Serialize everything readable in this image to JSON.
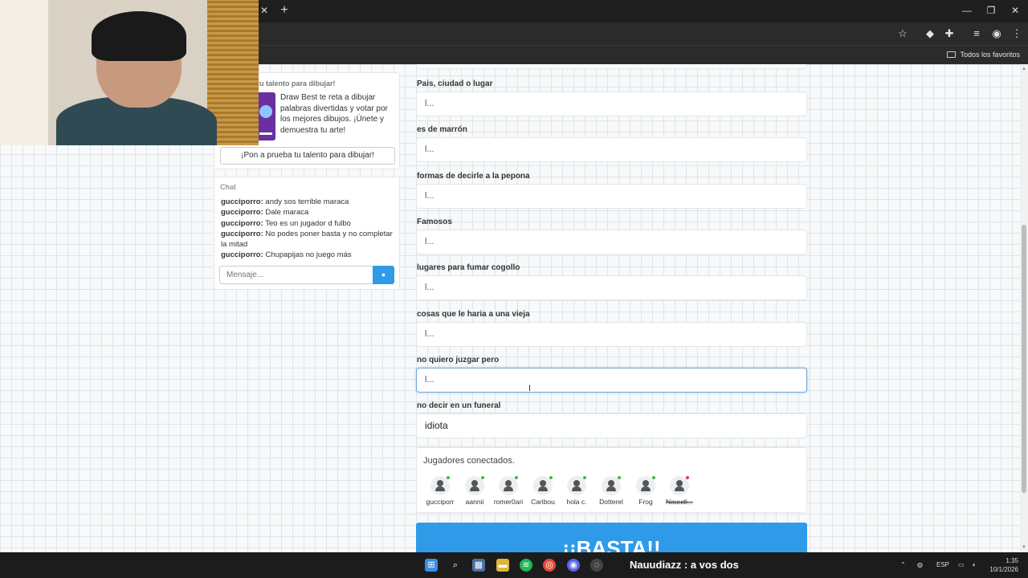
{
  "browser": {
    "tab_close": "✕",
    "tab_new": "+",
    "window_controls": {
      "minimize": "—",
      "maximize": "❐",
      "close": "✕"
    },
    "bookmark_folder_label": "Todos los favoritos"
  },
  "sidebar": {
    "promo": {
      "title": "ba tu talento para dibujar!",
      "description": "Draw Best te reta a dibujar palabras divertidas y votar por los mejores dibujos. ¡Únete y demuestra tu arte!",
      "button_label": "¡Pon a prueba tu talento para dibujar!"
    },
    "chat": {
      "title": "Chat",
      "messages": [
        {
          "user": "gucciporro:",
          "text": " andy sos terrible maraca"
        },
        {
          "user": "gucciporro:",
          "text": " Dale maraca"
        },
        {
          "user": "gucciporro:",
          "text": " Teo es un jugador d fulbo"
        },
        {
          "user": "gucciporro:",
          "text": " No podes poner basta y no completar la mitad"
        },
        {
          "user": "gucciporro:",
          "text": " Chupapijas no juego más"
        }
      ],
      "input_placeholder": "Mensaje..."
    }
  },
  "form": {
    "fields": [
      {
        "label": "Pais, ciudad o lugar",
        "value": "l..."
      },
      {
        "label": "es de marrón",
        "value": "l..."
      },
      {
        "label": "formas de decirle a la pepona",
        "value": "l..."
      },
      {
        "label": "Famosos",
        "value": "l..."
      },
      {
        "label": "lugares para fumar cogollo",
        "value": "l..."
      },
      {
        "label": "cosas que le haria a una vieja",
        "value": "l..."
      },
      {
        "label": "no quiero juzgar pero",
        "value": "l..."
      },
      {
        "label": "no decir en un funeral",
        "value": "idiota"
      }
    ]
  },
  "players": {
    "title": "Jugadores conectados.",
    "list": [
      {
        "name": "gucciporr",
        "status_color": "#4caf50"
      },
      {
        "name": "aannii",
        "status_color": "#4caf50"
      },
      {
        "name": "romer0ari",
        "status_color": "#4caf50"
      },
      {
        "name": "Caribou",
        "status_color": "#4caf50"
      },
      {
        "name": "hola c.",
        "status_color": "#4caf50"
      },
      {
        "name": "Dotterel",
        "status_color": "#4caf50"
      },
      {
        "name": "Frog",
        "status_color": "#4caf50"
      },
      {
        "name": "Nauudi...",
        "status_color": "#e53935"
      }
    ]
  },
  "basta_label": "¡¡BASTA!!",
  "taskbar": {
    "overlay_text": "Nauudiazz : a vos dos",
    "language": "ESP",
    "time": "1:35",
    "date": "10/1/2026"
  },
  "colors": {
    "accent": "#2f9ae8",
    "online": "#4caf50",
    "offline": "#e53935"
  }
}
